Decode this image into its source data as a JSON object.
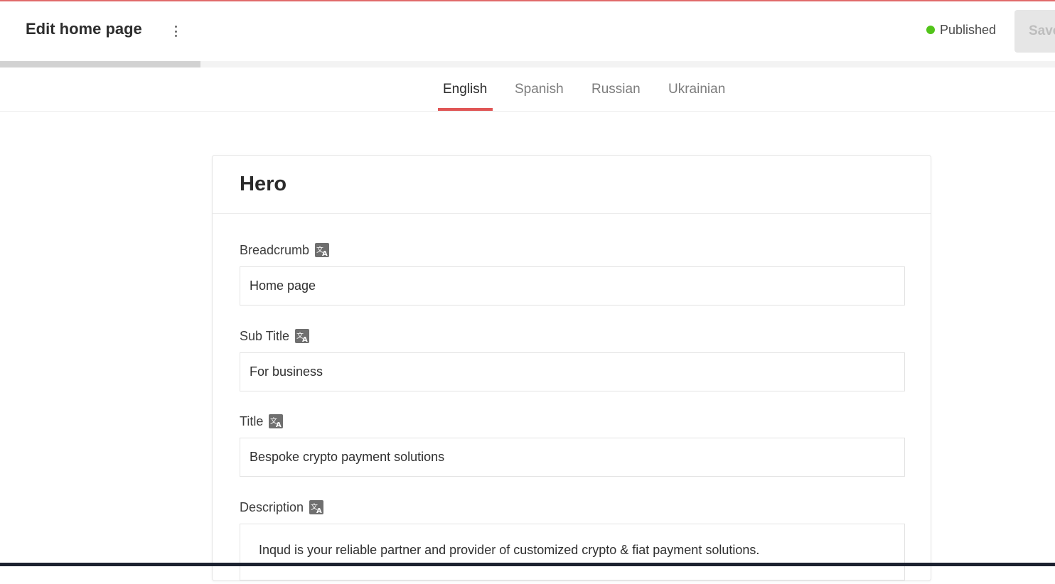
{
  "header": {
    "title": "Edit home page",
    "status_label": "Published",
    "status_color": "#52c41a",
    "save_label": "Save"
  },
  "progress": {
    "value_percent": 19
  },
  "tabs": [
    {
      "label": "English",
      "active": true
    },
    {
      "label": "Spanish",
      "active": false
    },
    {
      "label": "Russian",
      "active": false
    },
    {
      "label": "Ukrainian",
      "active": false
    }
  ],
  "card": {
    "title": "Hero",
    "fields": [
      {
        "label": "Breadcrumb",
        "value": "Home page",
        "icon": "translate-icon"
      },
      {
        "label": "Sub Title",
        "value": "For business",
        "icon": "translate-icon"
      },
      {
        "label": "Title",
        "value": "Bespoke crypto payment solutions",
        "icon": "translate-icon"
      },
      {
        "label": "Description",
        "value": "Inqud is your reliable partner and provider of customized crypto & fiat payment solutions.",
        "icon": "translate-icon"
      }
    ]
  }
}
